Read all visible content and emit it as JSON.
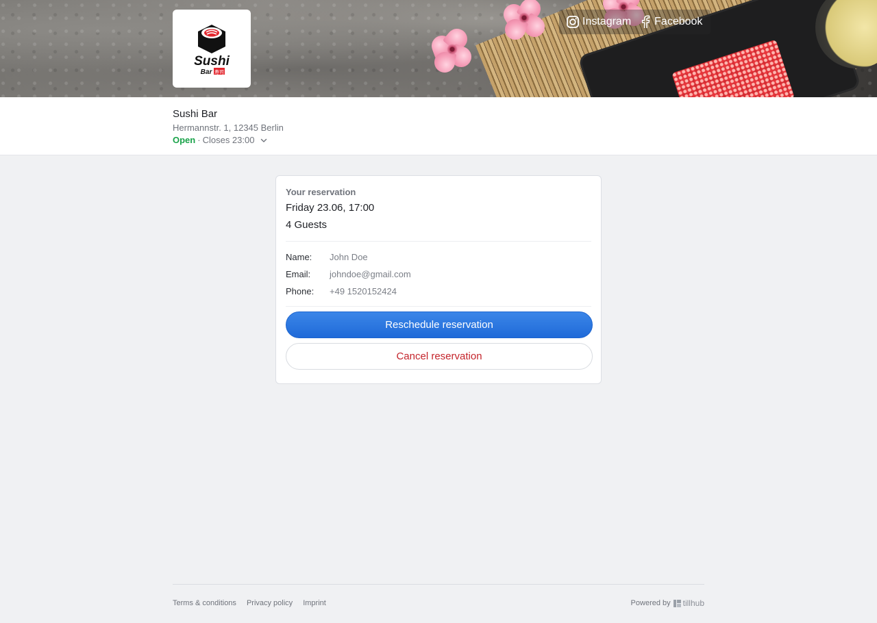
{
  "header": {
    "logo": {
      "brand_text": "Sushi",
      "sub_text": "Bar",
      "kanji": "寿司",
      "icon": "sushi-roll-logo"
    },
    "social": [
      {
        "label": "Instagram",
        "icon": "instagram-icon"
      },
      {
        "label": "Facebook",
        "icon": "facebook-icon"
      }
    ]
  },
  "restaurant": {
    "name": "Sushi Bar",
    "address": "Hermannstr. 1, 12345 Berlin",
    "status": "Open",
    "separator": "·",
    "closing": "Closes 23:00"
  },
  "reservation": {
    "heading": "Your reservation",
    "datetime": "Friday 23.06, 17:00",
    "guests": "4 Guests",
    "fields": [
      {
        "label": "Name:",
        "value": "John Doe"
      },
      {
        "label": "Email:",
        "value": "johndoe@gmail.com"
      },
      {
        "label": "Phone:",
        "value": "+49 1520152424"
      }
    ],
    "reschedule_label": "Reschedule reservation",
    "cancel_label": "Cancel reservation"
  },
  "footer": {
    "links": [
      "Terms & conditions",
      "Privacy policy",
      "Imprint"
    ],
    "powered_by": "Powered by",
    "brand": "tillhub"
  },
  "colors": {
    "primary": "#2876e0",
    "danger": "#c4242b",
    "open": "#1aa34a",
    "background": "#f0f1f3"
  }
}
